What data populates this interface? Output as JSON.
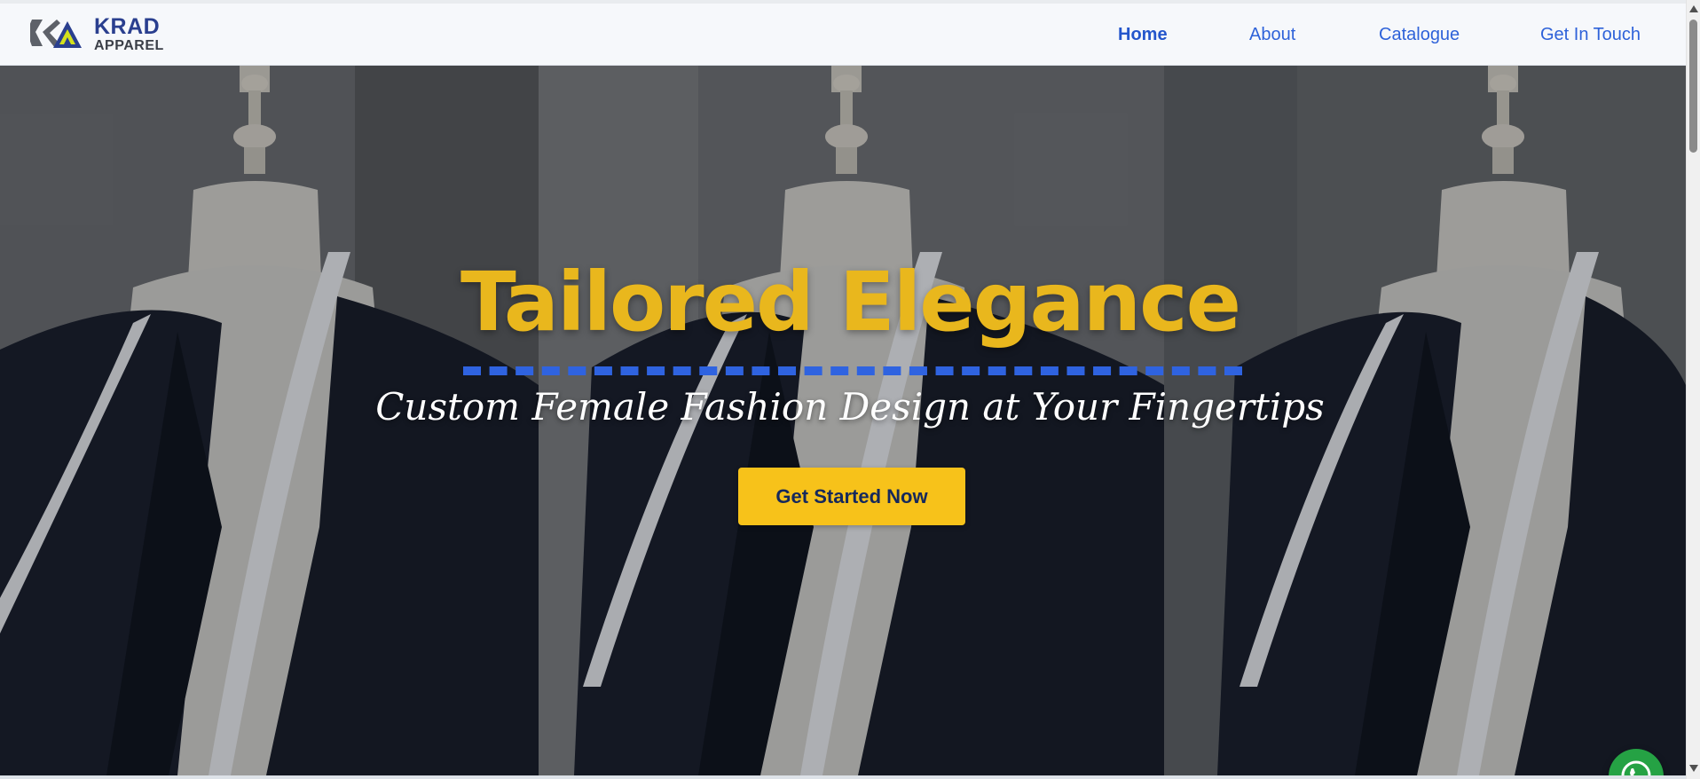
{
  "brand": {
    "line1": "KRAD",
    "line2": "APPAREL"
  },
  "nav": {
    "items": [
      {
        "label": "Home",
        "active": true
      },
      {
        "label": "About",
        "active": false
      },
      {
        "label": "Catalogue",
        "active": false
      },
      {
        "label": "Get In Touch",
        "active": false
      }
    ]
  },
  "hero": {
    "title": "Tailored Elegance",
    "subtitle": "Custom Female Fashion Design at Your Fingertips",
    "cta_label": "Get Started Now",
    "image_subject": "mannequin-with-tailored-jacket-and-measuring-tape"
  },
  "floating": {
    "icon": "whatsapp-icon"
  },
  "colors": {
    "nav_link": "#2e62d9",
    "title": "#e9b71d",
    "divider": "#2f63e0",
    "cta_bg": "#f7c21a",
    "cta_text": "#15285c",
    "whatsapp": "#25a244"
  }
}
